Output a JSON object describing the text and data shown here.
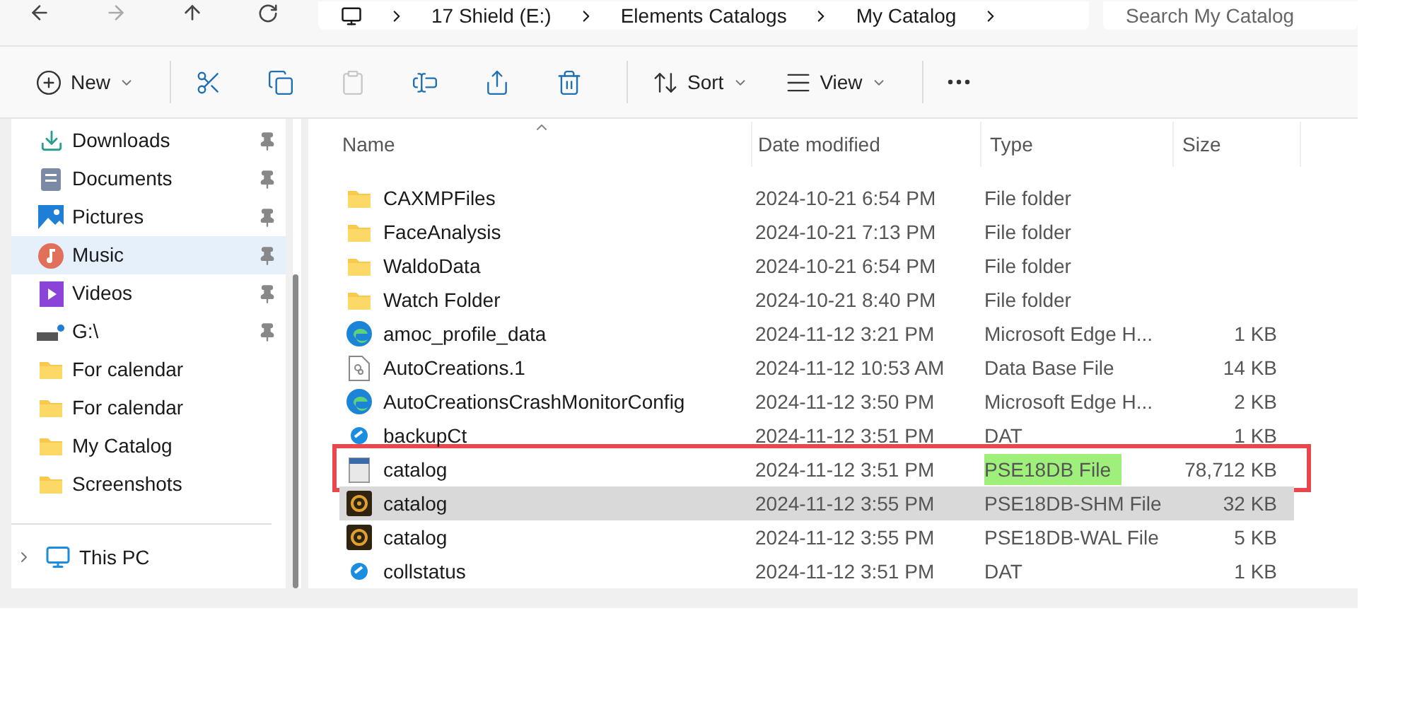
{
  "address_bar": {
    "segments": [
      "17 Shield (E:)",
      "Elements Catalogs",
      "My Catalog"
    ]
  },
  "search": {
    "placeholder": "Search My Catalog"
  },
  "toolbar": [
    {
      "kind": "new",
      "label": "New",
      "disabled": false
    },
    {
      "kind": "cut",
      "disabled": false
    },
    {
      "kind": "copy",
      "disabled": false
    },
    {
      "kind": "paste",
      "disabled": true
    },
    {
      "kind": "rename",
      "disabled": false
    },
    {
      "kind": "share",
      "disabled": false
    },
    {
      "kind": "delete",
      "disabled": false
    },
    {
      "kind": "sort",
      "label": "Sort",
      "disabled": false
    },
    {
      "kind": "view",
      "label": "View",
      "disabled": false
    },
    {
      "kind": "more",
      "disabled": false
    }
  ],
  "sidebar": {
    "items": [
      {
        "kind": "downloads",
        "label": "Downloads",
        "pinned": true,
        "selected": false
      },
      {
        "kind": "documents",
        "label": "Documents",
        "pinned": true,
        "selected": false
      },
      {
        "kind": "pictures",
        "label": "Pictures",
        "pinned": true,
        "selected": false
      },
      {
        "kind": "music",
        "label": "Music",
        "pinned": true,
        "selected": true
      },
      {
        "kind": "videos",
        "label": "Videos",
        "pinned": true,
        "selected": false
      },
      {
        "kind": "drive",
        "label": "G:\\",
        "pinned": true,
        "selected": false
      },
      {
        "kind": "folder",
        "label": "For calendar",
        "pinned": false,
        "selected": false
      },
      {
        "kind": "folder",
        "label": "For calendar",
        "pinned": false,
        "selected": false
      },
      {
        "kind": "folder",
        "label": "My Catalog",
        "pinned": false,
        "selected": false
      },
      {
        "kind": "folder",
        "label": "Screenshots",
        "pinned": false,
        "selected": false
      }
    ],
    "this_pc": {
      "label": "This PC",
      "expanded": false
    }
  },
  "table": {
    "columns": [
      "Name",
      "Date modified",
      "Type",
      "Size"
    ],
    "rows": [
      {
        "kind": "folder",
        "name": "CAXMPFiles",
        "date": "2024-10-21 6:54 PM",
        "type": "File folder",
        "size": "",
        "selected": false,
        "boxed": false,
        "type_highlighted": false
      },
      {
        "kind": "folder",
        "name": "FaceAnalysis",
        "date": "2024-10-21 7:13 PM",
        "type": "File folder",
        "size": "",
        "selected": false,
        "boxed": false,
        "type_highlighted": false
      },
      {
        "kind": "folder",
        "name": "WaldoData",
        "date": "2024-10-21 6:54 PM",
        "type": "File folder",
        "size": "",
        "selected": false,
        "boxed": false,
        "type_highlighted": false
      },
      {
        "kind": "folder",
        "name": "Watch Folder",
        "date": "2024-10-21 8:40 PM",
        "type": "File folder",
        "size": "",
        "selected": false,
        "boxed": false,
        "type_highlighted": false
      },
      {
        "kind": "edge",
        "name": "amoc_profile_data",
        "date": "2024-11-12 3:21 PM",
        "type": "Microsoft Edge H...",
        "size": "1 KB",
        "selected": false,
        "boxed": false,
        "type_highlighted": false
      },
      {
        "kind": "db",
        "name": "AutoCreations.1",
        "date": "2024-11-12 10:53 AM",
        "type": "Data Base File",
        "size": "14 KB",
        "selected": false,
        "boxed": false,
        "type_highlighted": false
      },
      {
        "kind": "edge",
        "name": "AutoCreationsCrashMonitorConfig",
        "date": "2024-11-12 3:50 PM",
        "type": "Microsoft Edge H...",
        "size": "2 KB",
        "selected": false,
        "boxed": false,
        "type_highlighted": false
      },
      {
        "kind": "dat",
        "name": "backupCt",
        "date": "2024-11-12 3:51 PM",
        "type": "DAT",
        "size": "1 KB",
        "selected": false,
        "boxed": false,
        "type_highlighted": false
      },
      {
        "kind": "catalog",
        "name": "catalog",
        "date": "2024-11-12 3:51 PM",
        "type": "PSE18DB File",
        "size": "78,712 KB",
        "selected": false,
        "boxed": true,
        "type_highlighted": true
      },
      {
        "kind": "elements",
        "name": "catalog",
        "date": "2024-11-12 3:55 PM",
        "type": "PSE18DB-SHM File",
        "size": "32 KB",
        "selected": true,
        "boxed": false,
        "type_highlighted": false
      },
      {
        "kind": "elements",
        "name": "catalog",
        "date": "2024-11-12 3:55 PM",
        "type": "PSE18DB-WAL File",
        "size": "5 KB",
        "selected": false,
        "boxed": false,
        "type_highlighted": false
      },
      {
        "kind": "dat",
        "name": "collstatus",
        "date": "2024-11-12 3:51 PM",
        "type": "DAT",
        "size": "1 KB",
        "selected": false,
        "boxed": false,
        "type_highlighted": false
      }
    ]
  }
}
